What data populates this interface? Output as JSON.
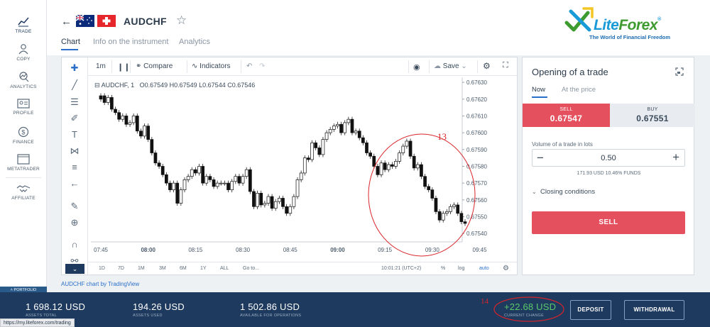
{
  "nav": {
    "items": [
      {
        "label": "TRADE"
      },
      {
        "label": "COPY"
      },
      {
        "label": "ANALYTICS"
      },
      {
        "label": "PROFILE"
      },
      {
        "label": "FINANCE"
      },
      {
        "label": "METATRADER"
      },
      {
        "label": "AFFILIATE"
      }
    ],
    "portfolio_label": "PORTFOLIO"
  },
  "header": {
    "instrument": "AUDCHF",
    "tabs": [
      {
        "label": "Chart"
      },
      {
        "label": "Info on the instrument"
      },
      {
        "label": "Analytics"
      }
    ]
  },
  "logo": {
    "brand": "LiteForex",
    "brand_first": "Lite",
    "brand_second": "Forex",
    "tagline": "The World of Financial Freedom",
    "reg_mark": "®"
  },
  "chart_toolbar": {
    "interval": "1m",
    "compare": "Compare",
    "indicators": "Indicators",
    "save": "Save"
  },
  "chart_legend": {
    "symbol": "AUDCHF, 1",
    "ohlc": "O0.67549 H0.67549 L0.67544 C0.67546"
  },
  "chart_bottom": {
    "ranges": [
      "1D",
      "7D",
      "1M",
      "3M",
      "6M",
      "1Y",
      "ALL"
    ],
    "goto": "Go to...",
    "clock": "10:01:21 (UTC+2)",
    "percent": "%",
    "log": "log",
    "auto": "auto"
  },
  "tv_credit": "AUDCHF chart by TradingView",
  "annotations": {
    "circle_label": "13",
    "balance_label": "14"
  },
  "chart_data": {
    "type": "candlestick",
    "x_ticks": [
      "07:45",
      "08:00",
      "08:15",
      "08:30",
      "08:45",
      "09:00",
      "09:15",
      "09:30",
      "09:45"
    ],
    "y_ticks": [
      "0.67630",
      "0.67620",
      "0.67610",
      "0.67600",
      "0.67590",
      "0.67580",
      "0.67570",
      "0.67560",
      "0.67550",
      "0.67540"
    ],
    "ylim": [
      0.67535,
      0.67633
    ],
    "series": [
      {
        "close": [
          0.6762,
          0.67618,
          0.67621,
          0.67614,
          0.67612,
          0.67608,
          0.6761,
          0.67605,
          0.67606,
          0.6761,
          0.67601,
          0.67598,
          0.67604,
          0.67596,
          0.67588,
          0.67582,
          0.6758,
          0.67575,
          0.6757,
          0.67566,
          0.6757,
          0.67558,
          0.67566,
          0.67572,
          0.67574,
          0.67578,
          0.67576,
          0.6758,
          0.6757,
          0.67574,
          0.67572,
          0.67568,
          0.6757,
          0.6757,
          0.6757,
          0.67566,
          0.67571,
          0.67574,
          0.6757,
          0.67574,
          0.67578,
          0.67565,
          0.67556,
          0.67564,
          0.67557,
          0.67558,
          0.67562,
          0.67555,
          0.67559,
          0.67561,
          0.67556,
          0.67552,
          0.67556,
          0.67562,
          0.67572,
          0.67576,
          0.67585,
          0.67584,
          0.67594,
          0.67591,
          0.67587,
          0.67596,
          0.676,
          0.67602,
          0.67604,
          0.67605,
          0.676,
          0.67606,
          0.67608,
          0.676,
          0.67601,
          0.67597,
          0.67594,
          0.67588,
          0.67586,
          0.6758,
          0.67575,
          0.67582,
          0.67578,
          0.67581,
          0.6758,
          0.67583,
          0.67588,
          0.67592,
          0.67595,
          0.67586,
          0.67579,
          0.67581,
          0.67574,
          0.67568,
          0.67566,
          0.67561,
          0.67553,
          0.67548,
          0.67552,
          0.67553,
          0.67556,
          0.67557,
          0.67552,
          0.67547,
          0.67546
        ],
        "open": [
          0.67622,
          0.67622,
          0.67618,
          0.67621,
          0.67614,
          0.67612,
          0.67608,
          0.6761,
          0.67605,
          0.67606,
          0.6761,
          0.67601,
          0.67598,
          0.67604,
          0.67596,
          0.67588,
          0.67582,
          0.6758,
          0.67575,
          0.6757,
          0.67566,
          0.6757,
          0.67558,
          0.67566,
          0.67572,
          0.67574,
          0.67578,
          0.67576,
          0.6758,
          0.6757,
          0.67574,
          0.67572,
          0.67568,
          0.6757,
          0.6757,
          0.6757,
          0.67566,
          0.67571,
          0.67574,
          0.6757,
          0.67574,
          0.67578,
          0.67565,
          0.67556,
          0.67564,
          0.67557,
          0.67558,
          0.67562,
          0.67555,
          0.67559,
          0.67561,
          0.67556,
          0.67552,
          0.67556,
          0.67562,
          0.67572,
          0.67576,
          0.67585,
          0.67584,
          0.67594,
          0.67591,
          0.67587,
          0.67596,
          0.676,
          0.67602,
          0.67604,
          0.67605,
          0.676,
          0.67606,
          0.67608,
          0.676,
          0.67601,
          0.67597,
          0.67594,
          0.67588,
          0.67586,
          0.6758,
          0.67575,
          0.67582,
          0.67578,
          0.67581,
          0.6758,
          0.67583,
          0.67588,
          0.67592,
          0.67595,
          0.67586,
          0.67579,
          0.67581,
          0.67574,
          0.67568,
          0.67566,
          0.67561,
          0.67553,
          0.67548,
          0.67552,
          0.67553,
          0.67556,
          0.67557,
          0.67552,
          0.67547
        ]
      }
    ]
  },
  "trade_panel": {
    "title": "Opening of a trade",
    "tabs": [
      {
        "label": "Now"
      },
      {
        "label": "At the price"
      }
    ],
    "sell_label": "SELL",
    "sell_price": "0.67547",
    "buy_label": "BUY",
    "buy_price": "0.67551",
    "volume_label": "Volume of a trade in lots",
    "volume_value": "0.50",
    "funds_text": "171.93 USD  10.46% FUNDS",
    "closing_conditions": "Closing conditions",
    "sell_button": "SELL"
  },
  "bottom_bar": {
    "balance_value": "1 698.12 USD",
    "balance_label": "ASSETS TOTAL",
    "assets_used_value": "194.26 USD",
    "assets_used_label": "ASSETS USED",
    "available_value": "1 502.86 USD",
    "available_label": "AVAILABLE FOR OPERATIONS",
    "change_value": "+22.68 USD",
    "change_label": "CURRENT CHANGE",
    "deposit": "DEPOSIT",
    "withdrawal": "WITHDRAWAL"
  },
  "status_url": "https://my.liteforex.com/trading"
}
